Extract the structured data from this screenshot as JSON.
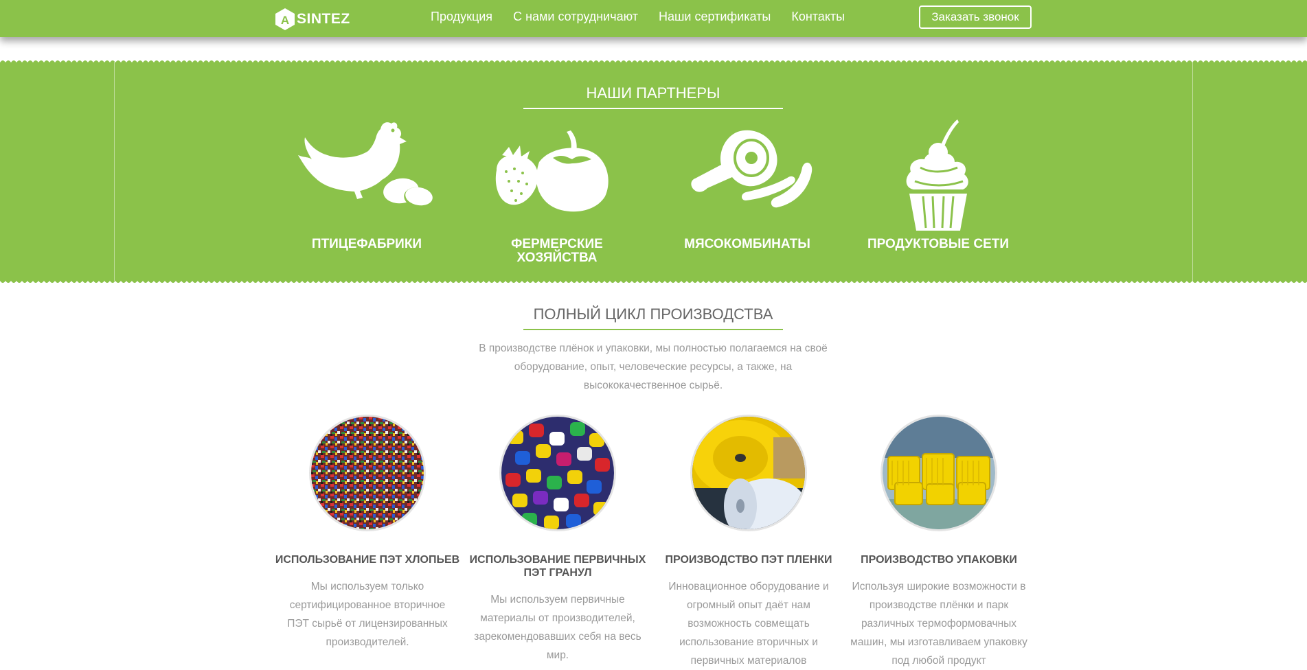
{
  "header": {
    "logo_letter": "A",
    "logo_text": "SINTEZ",
    "nav": [
      "Продукция",
      "С нами сотрудничают",
      "Наши сертификаты",
      "Контакты"
    ],
    "call_button": "Заказать звонок"
  },
  "partners": {
    "title": "НАШИ ПАРТНЕРЫ",
    "items": [
      {
        "label": "ПТИЦЕФАБРИКИ",
        "icon": "chicken-icon"
      },
      {
        "label": "ФЕРМЕРСКИЕ ХОЗЯЙСТВА",
        "icon": "vegetables-icon"
      },
      {
        "label": "МЯСОКОМБИНАТЫ",
        "icon": "meat-icon"
      },
      {
        "label": "ПРОДУКТОВЫЕ СЕТИ",
        "icon": "cupcake-icon"
      }
    ]
  },
  "cycle": {
    "title": "ПОЛНЫЙ ЦИКЛ ПРОИЗВОДСТВА",
    "description": "В производстве плёнок и упаковки, мы полностью полагаемся на своё оборудование, опыт, человеческие ресурсы, а также, на высококачественное сырьё.",
    "steps": [
      {
        "title": "ИСПОЛЬЗОВАНИЕ ПЭТ ХЛОПЬЕВ",
        "text": "Мы используем только сертифицированное вторичное ПЭТ сырьё от лицензированных производителей.",
        "image": "pet-flakes-image"
      },
      {
        "title": "ИСПОЛЬЗОВАНИЕ ПЕРВИЧНЫХ ПЭТ ГРАНУЛ",
        "text": "Мы используем первичные материалы от производителей, зарекомендовавших себя на весь мир.",
        "image": "pet-granules-image"
      },
      {
        "title": "ПРОИЗВОДСТВО ПЭТ ПЛЕНКИ",
        "text": "Инновационное оборудование и огромный опыт даёт нам возможность совмещать использование вторичных и первичных материалов",
        "image": "film-rolls-image"
      },
      {
        "title": "ПРОИЗВОДСТВО УПАКОВКИ",
        "text": "Используя широкие возможности в производстве плёнки и парк различных термоформовачных машин, мы изготавливаем упаковку под любой продукт",
        "image": "packaging-image"
      }
    ]
  },
  "colors": {
    "accent": "#8bc24a",
    "text": "#777777",
    "muted": "#999999"
  }
}
